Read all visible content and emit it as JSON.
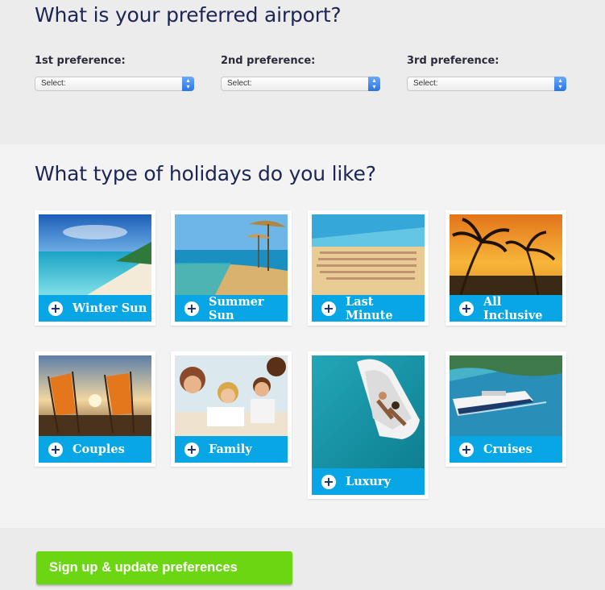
{
  "airport": {
    "title": "What is your preferred airport?",
    "preferences": [
      {
        "label": "1st preference:",
        "value": "Select:"
      },
      {
        "label": "2nd preference:",
        "value": "Select:"
      },
      {
        "label": "3rd preference:",
        "value": "Select:"
      }
    ]
  },
  "holidays": {
    "title": "What type of holidays do you like?",
    "cards": [
      {
        "label": "Winter Sun",
        "icon": "plus-icon"
      },
      {
        "label": "Summer Sun",
        "icon": "plus-icon"
      },
      {
        "label": "Last Minute",
        "icon": "plus-icon"
      },
      {
        "label": "All Inclusive",
        "icon": "plus-icon"
      },
      {
        "label": "Couples",
        "icon": "plus-icon"
      },
      {
        "label": "Family",
        "icon": "plus-icon"
      },
      {
        "label": "Luxury",
        "icon": "plus-icon"
      },
      {
        "label": "Cruises",
        "icon": "plus-icon"
      }
    ]
  },
  "footer": {
    "submit_label": "Sign up & update preferences"
  },
  "colors": {
    "heading": "#1d2553",
    "card_bar": "#08a6e4",
    "cta": "#6bd611"
  }
}
